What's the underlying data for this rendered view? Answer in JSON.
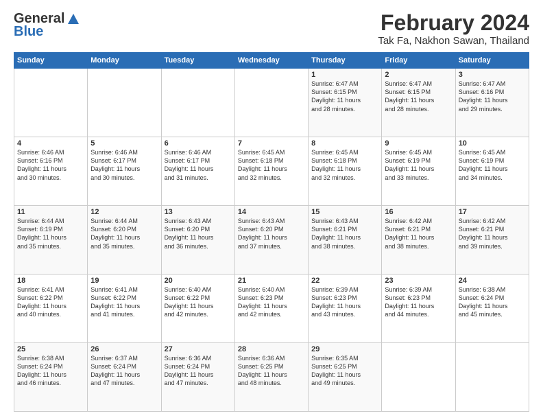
{
  "header": {
    "logo_general": "General",
    "logo_blue": "Blue",
    "month_title": "February 2024",
    "location": "Tak Fa, Nakhon Sawan, Thailand"
  },
  "days_of_week": [
    "Sunday",
    "Monday",
    "Tuesday",
    "Wednesday",
    "Thursday",
    "Friday",
    "Saturday"
  ],
  "weeks": [
    [
      {
        "num": "",
        "info": ""
      },
      {
        "num": "",
        "info": ""
      },
      {
        "num": "",
        "info": ""
      },
      {
        "num": "",
        "info": ""
      },
      {
        "num": "1",
        "info": "Sunrise: 6:47 AM\nSunset: 6:15 PM\nDaylight: 11 hours\nand 28 minutes."
      },
      {
        "num": "2",
        "info": "Sunrise: 6:47 AM\nSunset: 6:15 PM\nDaylight: 11 hours\nand 28 minutes."
      },
      {
        "num": "3",
        "info": "Sunrise: 6:47 AM\nSunset: 6:16 PM\nDaylight: 11 hours\nand 29 minutes."
      }
    ],
    [
      {
        "num": "4",
        "info": "Sunrise: 6:46 AM\nSunset: 6:16 PM\nDaylight: 11 hours\nand 30 minutes."
      },
      {
        "num": "5",
        "info": "Sunrise: 6:46 AM\nSunset: 6:17 PM\nDaylight: 11 hours\nand 30 minutes."
      },
      {
        "num": "6",
        "info": "Sunrise: 6:46 AM\nSunset: 6:17 PM\nDaylight: 11 hours\nand 31 minutes."
      },
      {
        "num": "7",
        "info": "Sunrise: 6:45 AM\nSunset: 6:18 PM\nDaylight: 11 hours\nand 32 minutes."
      },
      {
        "num": "8",
        "info": "Sunrise: 6:45 AM\nSunset: 6:18 PM\nDaylight: 11 hours\nand 32 minutes."
      },
      {
        "num": "9",
        "info": "Sunrise: 6:45 AM\nSunset: 6:19 PM\nDaylight: 11 hours\nand 33 minutes."
      },
      {
        "num": "10",
        "info": "Sunrise: 6:45 AM\nSunset: 6:19 PM\nDaylight: 11 hours\nand 34 minutes."
      }
    ],
    [
      {
        "num": "11",
        "info": "Sunrise: 6:44 AM\nSunset: 6:19 PM\nDaylight: 11 hours\nand 35 minutes."
      },
      {
        "num": "12",
        "info": "Sunrise: 6:44 AM\nSunset: 6:20 PM\nDaylight: 11 hours\nand 35 minutes."
      },
      {
        "num": "13",
        "info": "Sunrise: 6:43 AM\nSunset: 6:20 PM\nDaylight: 11 hours\nand 36 minutes."
      },
      {
        "num": "14",
        "info": "Sunrise: 6:43 AM\nSunset: 6:20 PM\nDaylight: 11 hours\nand 37 minutes."
      },
      {
        "num": "15",
        "info": "Sunrise: 6:43 AM\nSunset: 6:21 PM\nDaylight: 11 hours\nand 38 minutes."
      },
      {
        "num": "16",
        "info": "Sunrise: 6:42 AM\nSunset: 6:21 PM\nDaylight: 11 hours\nand 38 minutes."
      },
      {
        "num": "17",
        "info": "Sunrise: 6:42 AM\nSunset: 6:21 PM\nDaylight: 11 hours\nand 39 minutes."
      }
    ],
    [
      {
        "num": "18",
        "info": "Sunrise: 6:41 AM\nSunset: 6:22 PM\nDaylight: 11 hours\nand 40 minutes."
      },
      {
        "num": "19",
        "info": "Sunrise: 6:41 AM\nSunset: 6:22 PM\nDaylight: 11 hours\nand 41 minutes."
      },
      {
        "num": "20",
        "info": "Sunrise: 6:40 AM\nSunset: 6:22 PM\nDaylight: 11 hours\nand 42 minutes."
      },
      {
        "num": "21",
        "info": "Sunrise: 6:40 AM\nSunset: 6:23 PM\nDaylight: 11 hours\nand 42 minutes."
      },
      {
        "num": "22",
        "info": "Sunrise: 6:39 AM\nSunset: 6:23 PM\nDaylight: 11 hours\nand 43 minutes."
      },
      {
        "num": "23",
        "info": "Sunrise: 6:39 AM\nSunset: 6:23 PM\nDaylight: 11 hours\nand 44 minutes."
      },
      {
        "num": "24",
        "info": "Sunrise: 6:38 AM\nSunset: 6:24 PM\nDaylight: 11 hours\nand 45 minutes."
      }
    ],
    [
      {
        "num": "25",
        "info": "Sunrise: 6:38 AM\nSunset: 6:24 PM\nDaylight: 11 hours\nand 46 minutes."
      },
      {
        "num": "26",
        "info": "Sunrise: 6:37 AM\nSunset: 6:24 PM\nDaylight: 11 hours\nand 47 minutes."
      },
      {
        "num": "27",
        "info": "Sunrise: 6:36 AM\nSunset: 6:24 PM\nDaylight: 11 hours\nand 47 minutes."
      },
      {
        "num": "28",
        "info": "Sunrise: 6:36 AM\nSunset: 6:25 PM\nDaylight: 11 hours\nand 48 minutes."
      },
      {
        "num": "29",
        "info": "Sunrise: 6:35 AM\nSunset: 6:25 PM\nDaylight: 11 hours\nand 49 minutes."
      },
      {
        "num": "",
        "info": ""
      },
      {
        "num": "",
        "info": ""
      }
    ]
  ]
}
